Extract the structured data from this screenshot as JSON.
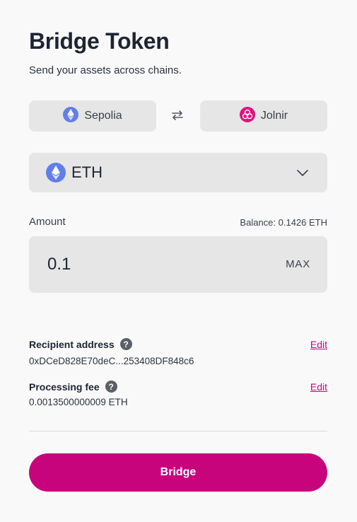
{
  "header": {
    "title": "Bridge Token",
    "subtitle": "Send your assets across chains."
  },
  "chains": {
    "from": {
      "label": "Sepolia",
      "icon": "ethereum-icon"
    },
    "to": {
      "label": "Jolnir",
      "icon": "jolnir-icon"
    },
    "swap_icon": "swap-arrows-icon"
  },
  "token": {
    "selected": "ETH",
    "icon": "ethereum-icon",
    "chevron": "chevron-down-icon"
  },
  "amount": {
    "label": "Amount",
    "balance": "Balance: 0.1426 ETH",
    "value": "0.1",
    "max_label": "MAX"
  },
  "recipient": {
    "label": "Recipient address",
    "value": "0xDCeD828E70deC...253408DF848c6",
    "edit_label": "Edit"
  },
  "fee": {
    "label": "Processing fee",
    "value": "0.0013500000009 ETH",
    "edit_label": "Edit"
  },
  "bridge_button": "Bridge",
  "colors": {
    "accent": "#c8047d",
    "ethereum": "#627eea",
    "field_bg": "#e6e6e6"
  }
}
